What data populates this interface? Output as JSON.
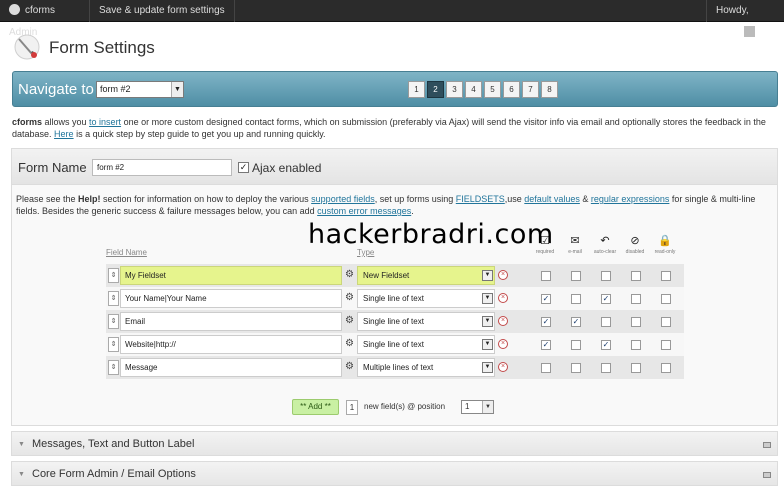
{
  "adminbar": {
    "app_name": "cforms Admin",
    "save_label": "Save & update form settings",
    "howdy": "Howdy,"
  },
  "page": {
    "title": "Form Settings"
  },
  "navigate": {
    "label": "Navigate to",
    "selected_form": "form #2",
    "pages": [
      "1",
      "2",
      "3",
      "4",
      "5",
      "6",
      "7",
      "8"
    ],
    "active_page": "2"
  },
  "intro": {
    "brand": "cforms",
    "t1": " allows you ",
    "link1": "to insert",
    "t2": " one or more custom designed contact forms, which on submission (preferably via Ajax) will send the visitor info via email and optionally stores the feedback in the database. ",
    "link2": "Here",
    "t3": " is a quick step by step guide to get you up and running quickly."
  },
  "form": {
    "name_label": "Form Name",
    "name_value": "form #2",
    "ajax_label": "Ajax enabled",
    "ajax_checked": true
  },
  "help": {
    "t1": "Please see the ",
    "bold": "Help!",
    "t2": " section for information on how to deploy the various ",
    "link1": "supported fields",
    "t3": ", set up forms using ",
    "link2": "FIELDSETS",
    "t4": ",use ",
    "link3": "default values",
    "t5": " & ",
    "link4": "regular expressions",
    "t6": " for single & multi-line fields. Besides the generic success & failure messages below, you can add ",
    "link5": "custom error messages",
    "t7": "."
  },
  "table": {
    "col_name": "Field Name",
    "col_type": "Type",
    "flag_headers": [
      {
        "label": "required",
        "icon": "check"
      },
      {
        "label": "e-mail",
        "icon": "email"
      },
      {
        "label": "auto-clear",
        "icon": "undo-arrow"
      },
      {
        "label": "disabled",
        "icon": "no-entry"
      },
      {
        "label": "read-only",
        "icon": "lock"
      }
    ],
    "rows": [
      {
        "name": "My Fieldset",
        "type": "New Fieldset",
        "flags": [
          false,
          false,
          false,
          false,
          false
        ]
      },
      {
        "name": "Your Name|Your Name",
        "type": "Single line of text",
        "flags": [
          true,
          false,
          true,
          false,
          false
        ]
      },
      {
        "name": "Email",
        "type": "Single line of text",
        "flags": [
          true,
          true,
          false,
          false,
          false
        ]
      },
      {
        "name": "Website|http://",
        "type": "Single line of text",
        "flags": [
          true,
          false,
          true,
          false,
          false
        ]
      },
      {
        "name": "Message",
        "type": "Multiple lines of text",
        "flags": [
          false,
          false,
          false,
          false,
          false
        ]
      }
    ]
  },
  "add": {
    "button_label": "** Add **",
    "count": "1",
    "text": "new field(s) @ position",
    "position": "1"
  },
  "sections": [
    {
      "title": "Messages, Text and Button Label"
    },
    {
      "title": "Core Form Admin / Email Options"
    }
  ],
  "watermark": "hackerbradri.com",
  "colors": {
    "nav_bar": "#5f9db2",
    "fieldset_highlight": "#e6f48d",
    "add_button": "#c9f0a3",
    "link": "#21759b"
  }
}
